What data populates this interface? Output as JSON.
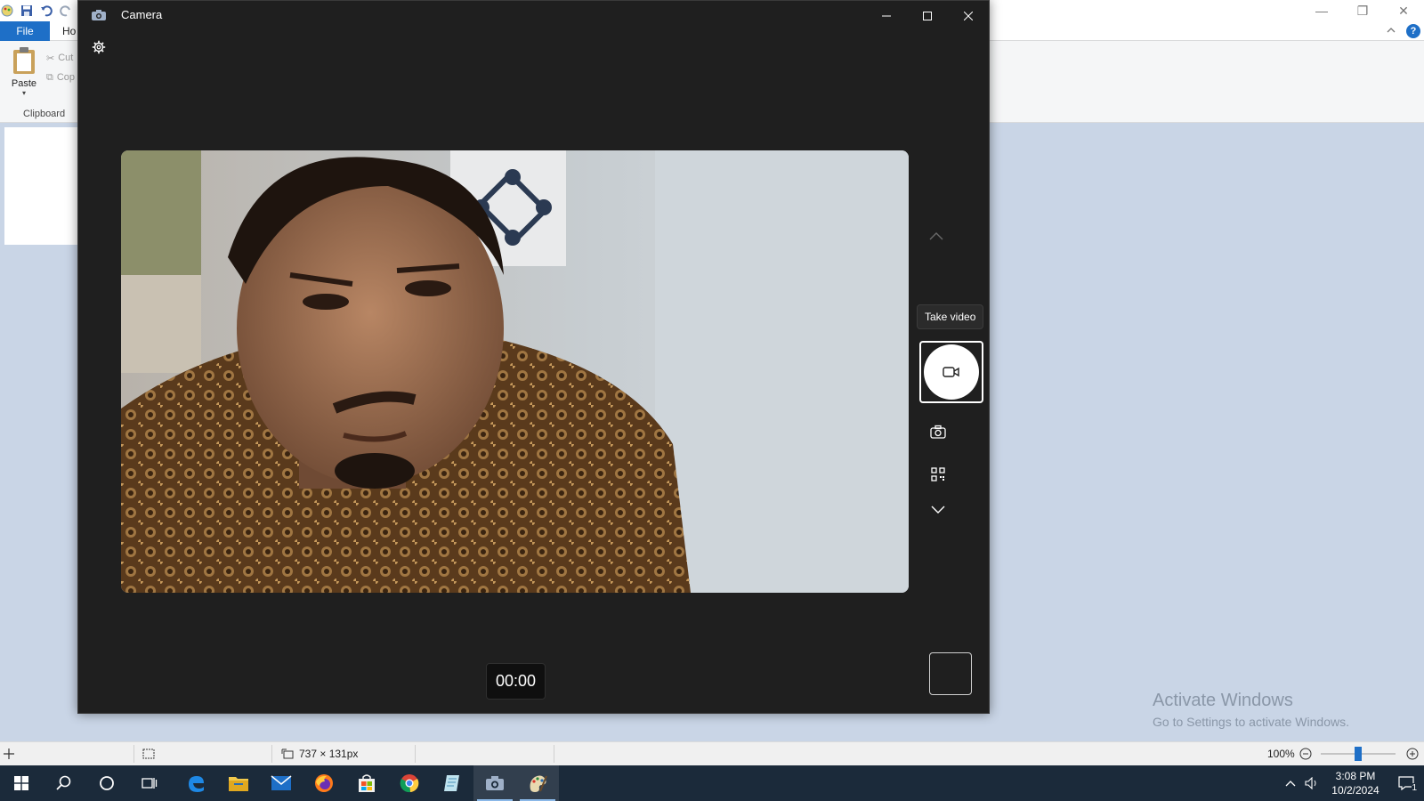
{
  "paint": {
    "tabs": {
      "file": "File",
      "home_partial": "Ho"
    },
    "clipboard": {
      "paste": "Paste",
      "cut": "Cut",
      "copy": "Cop",
      "group_label": "Clipboard"
    },
    "statusbar": {
      "dimensions": "737 × 131px",
      "zoom": "100%"
    },
    "help": "?"
  },
  "watermark": {
    "title": "Activate Windows",
    "subtitle": "Go to Settings to activate Windows."
  },
  "camera": {
    "title": "Camera",
    "tooltip": "Take video",
    "timer": "00:00",
    "icons": [
      "camera-app-icon",
      "settings-icon",
      "chevron-up-icon",
      "video-icon",
      "photo-icon",
      "qr-scan-icon",
      "chevron-down-icon"
    ]
  },
  "taskbar": {
    "clock_time": "3:08 PM",
    "clock_date": "10/2/2024",
    "notification_count": "1",
    "apps": [
      "windows-start",
      "search",
      "cortana",
      "task-view",
      "edge",
      "file-explorer",
      "mail",
      "firefox",
      "store",
      "chrome",
      "notes",
      "camera",
      "paint"
    ]
  },
  "colors": {
    "accent": "#1e6fc7",
    "camera_bg": "#1f1f1f",
    "taskbar_bg": "#1b2a3a"
  }
}
